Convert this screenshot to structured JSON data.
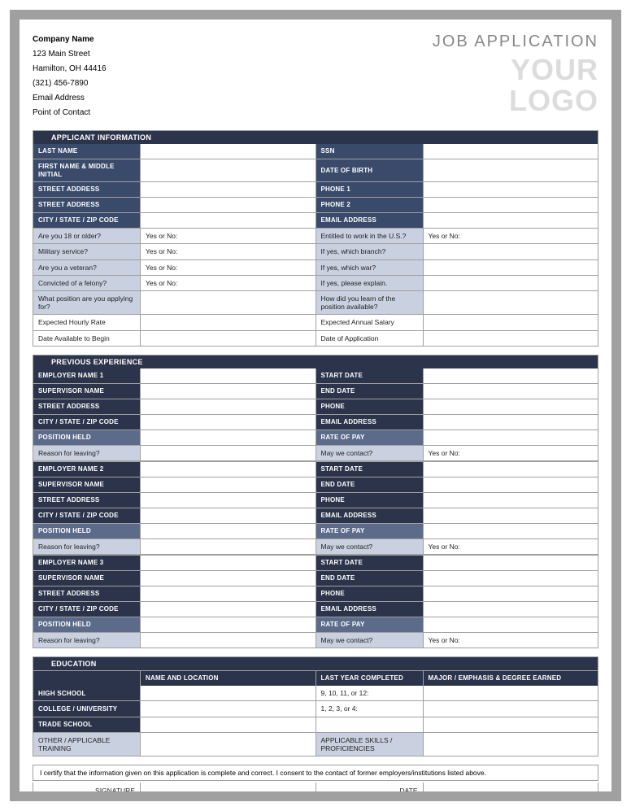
{
  "header": {
    "company_name": "Company Name",
    "address1": "123 Main Street",
    "address2": "Hamilton, OH 44416",
    "phone": "(321) 456-7890",
    "email": "Email Address",
    "poc": "Point of Contact",
    "title": "JOB APPLICATION",
    "logo1": "YOUR",
    "logo2": "LOGO"
  },
  "sections": {
    "applicant": {
      "title": "APPLICANT INFORMATION",
      "rows": [
        {
          "l1": "LAST NAME",
          "c1": "lbl-dark",
          "v1": "",
          "l2": "SSN",
          "c2": "lbl-dark",
          "v2": ""
        },
        {
          "l1": "FIRST NAME & MIDDLE INITIAL",
          "c1": "lbl-dark",
          "v1": "",
          "l2": "DATE OF BIRTH",
          "c2": "lbl-dark",
          "v2": ""
        },
        {
          "l1": "STREET ADDRESS",
          "c1": "lbl-dark",
          "v1": "",
          "l2": "PHONE 1",
          "c2": "lbl-dark",
          "v2": ""
        },
        {
          "l1": "STREET ADDRESS",
          "c1": "lbl-dark",
          "v1": "",
          "l2": "PHONE 2",
          "c2": "lbl-dark",
          "v2": ""
        },
        {
          "l1": "CITY / STATE / ZIP CODE",
          "c1": "lbl-dark",
          "v1": "",
          "l2": "EMAIL ADDRESS",
          "c2": "lbl-dark",
          "v2": ""
        },
        {
          "l1": "Are you 18 or older?",
          "c1": "lbl-light",
          "v1": "Yes or No:",
          "l2": "Entitled to work in the U.S.?",
          "c2": "lbl-light",
          "v2": "Yes or No:"
        },
        {
          "l1": "Military service?",
          "c1": "lbl-light",
          "v1": "Yes or No:",
          "l2": "If yes, which branch?",
          "c2": "lbl-light",
          "v2": ""
        },
        {
          "l1": "Are you a veteran?",
          "c1": "lbl-light",
          "v1": "Yes or No:",
          "l2": "If yes, which war?",
          "c2": "lbl-light",
          "v2": ""
        },
        {
          "l1": "Convicted of a felony?",
          "c1": "lbl-light",
          "v1": "Yes or No:",
          "l2": "If yes, please explain.",
          "c2": "lbl-light",
          "v2": ""
        },
        {
          "l1": "What position are you applying for?",
          "c1": "lbl-light",
          "v1": "",
          "l2": "How did you learn of the position available?",
          "c2": "lbl-light",
          "v2": "",
          "tall": true
        },
        {
          "l1": "Expected Hourly Rate",
          "c1": "lbl-white",
          "v1": "",
          "l2": "Expected Annual Salary",
          "c2": "lbl-white",
          "v2": ""
        },
        {
          "l1": "Date Available to Begin",
          "c1": "lbl-white",
          "v1": "",
          "l2": "Date of Application",
          "c2": "lbl-white",
          "v2": ""
        }
      ]
    },
    "experience": {
      "title": "PREVIOUS EXPERIENCE",
      "blocks": [
        {
          "rows": [
            {
              "l1": "EMPLOYER NAME 1",
              "c1": "lbl-dark2",
              "l2": "START DATE",
              "c2": "lbl-dark2"
            },
            {
              "l1": "SUPERVISOR NAME",
              "c1": "lbl-dark2",
              "l2": "END DATE",
              "c2": "lbl-dark2"
            },
            {
              "l1": "STREET ADDRESS",
              "c1": "lbl-dark2",
              "l2": "PHONE",
              "c2": "lbl-dark2"
            },
            {
              "l1": "CITY / STATE / ZIP CODE",
              "c1": "lbl-dark2",
              "l2": "EMAIL ADDRESS",
              "c2": "lbl-dark2"
            },
            {
              "l1": "POSITION HELD",
              "c1": "lbl-steel",
              "l2": "RATE OF PAY",
              "c2": "lbl-steel"
            },
            {
              "l1": "Reason for leaving?",
              "c1": "lbl-light",
              "l2": "May we contact?",
              "c2": "lbl-light",
              "v2": "Yes or No:"
            }
          ]
        },
        {
          "rows": [
            {
              "l1": "EMPLOYER NAME 2",
              "c1": "lbl-dark2",
              "l2": "START DATE",
              "c2": "lbl-dark2"
            },
            {
              "l1": "SUPERVISOR NAME",
              "c1": "lbl-dark2",
              "l2": "END DATE",
              "c2": "lbl-dark2"
            },
            {
              "l1": "STREET ADDRESS",
              "c1": "lbl-dark2",
              "l2": "PHONE",
              "c2": "lbl-dark2"
            },
            {
              "l1": "CITY / STATE / ZIP CODE",
              "c1": "lbl-dark2",
              "l2": "EMAIL ADDRESS",
              "c2": "lbl-dark2"
            },
            {
              "l1": "POSITION HELD",
              "c1": "lbl-steel",
              "l2": "RATE OF PAY",
              "c2": "lbl-steel"
            },
            {
              "l1": "Reason for leaving?",
              "c1": "lbl-light",
              "l2": "May we contact?",
              "c2": "lbl-light",
              "v2": "Yes or No:"
            }
          ]
        },
        {
          "rows": [
            {
              "l1": "EMPLOYER NAME 3",
              "c1": "lbl-dark2",
              "l2": "START DATE",
              "c2": "lbl-dark2"
            },
            {
              "l1": "SUPERVISOR NAME",
              "c1": "lbl-dark2",
              "l2": "END DATE",
              "c2": "lbl-dark2"
            },
            {
              "l1": "STREET ADDRESS",
              "c1": "lbl-dark2",
              "l2": "PHONE",
              "c2": "lbl-dark2"
            },
            {
              "l1": "CITY / STATE / ZIP CODE",
              "c1": "lbl-dark2",
              "l2": "EMAIL ADDRESS",
              "c2": "lbl-dark2"
            },
            {
              "l1": "POSITION HELD",
              "c1": "lbl-steel",
              "l2": "RATE OF PAY",
              "c2": "lbl-steel"
            },
            {
              "l1": "Reason for leaving?",
              "c1": "lbl-light",
              "l2": "May we contact?",
              "c2": "lbl-light",
              "v2": "Yes or No:"
            }
          ]
        }
      ]
    },
    "education": {
      "title": "EDUCATION",
      "header": {
        "c1": "",
        "c2": "NAME AND LOCATION",
        "c3": "LAST YEAR COMPLETED",
        "c4": "MAJOR / EMPHASIS & DEGREE EARNED"
      },
      "rows": [
        {
          "c1": "HIGH SCHOOL",
          "s1": "lbl-dark2",
          "c2": "",
          "c3": "9, 10, 11, or 12:",
          "c4": ""
        },
        {
          "c1": "COLLEGE / UNIVERSITY",
          "s1": "lbl-dark2",
          "c2": "",
          "c3": "1, 2, 3, or 4:",
          "c4": ""
        },
        {
          "c1": "TRADE SCHOOL",
          "s1": "lbl-dark2",
          "c2": "",
          "c3": "",
          "c4": ""
        },
        {
          "c1": "OTHER / APPLICABLE TRAINING",
          "s1": "lbl-light",
          "c2": "",
          "c3": "APPLICABLE SKILLS / PROFICIENCIES",
          "s3": "lbl-light",
          "c4": "",
          "tall": true
        }
      ]
    }
  },
  "cert": "I certify that the information given on this application is complete and correct. I consent to the contact of former employers/institutions listed above.",
  "sig": {
    "sig_label": "SIGNATURE",
    "date_label": "DATE"
  }
}
